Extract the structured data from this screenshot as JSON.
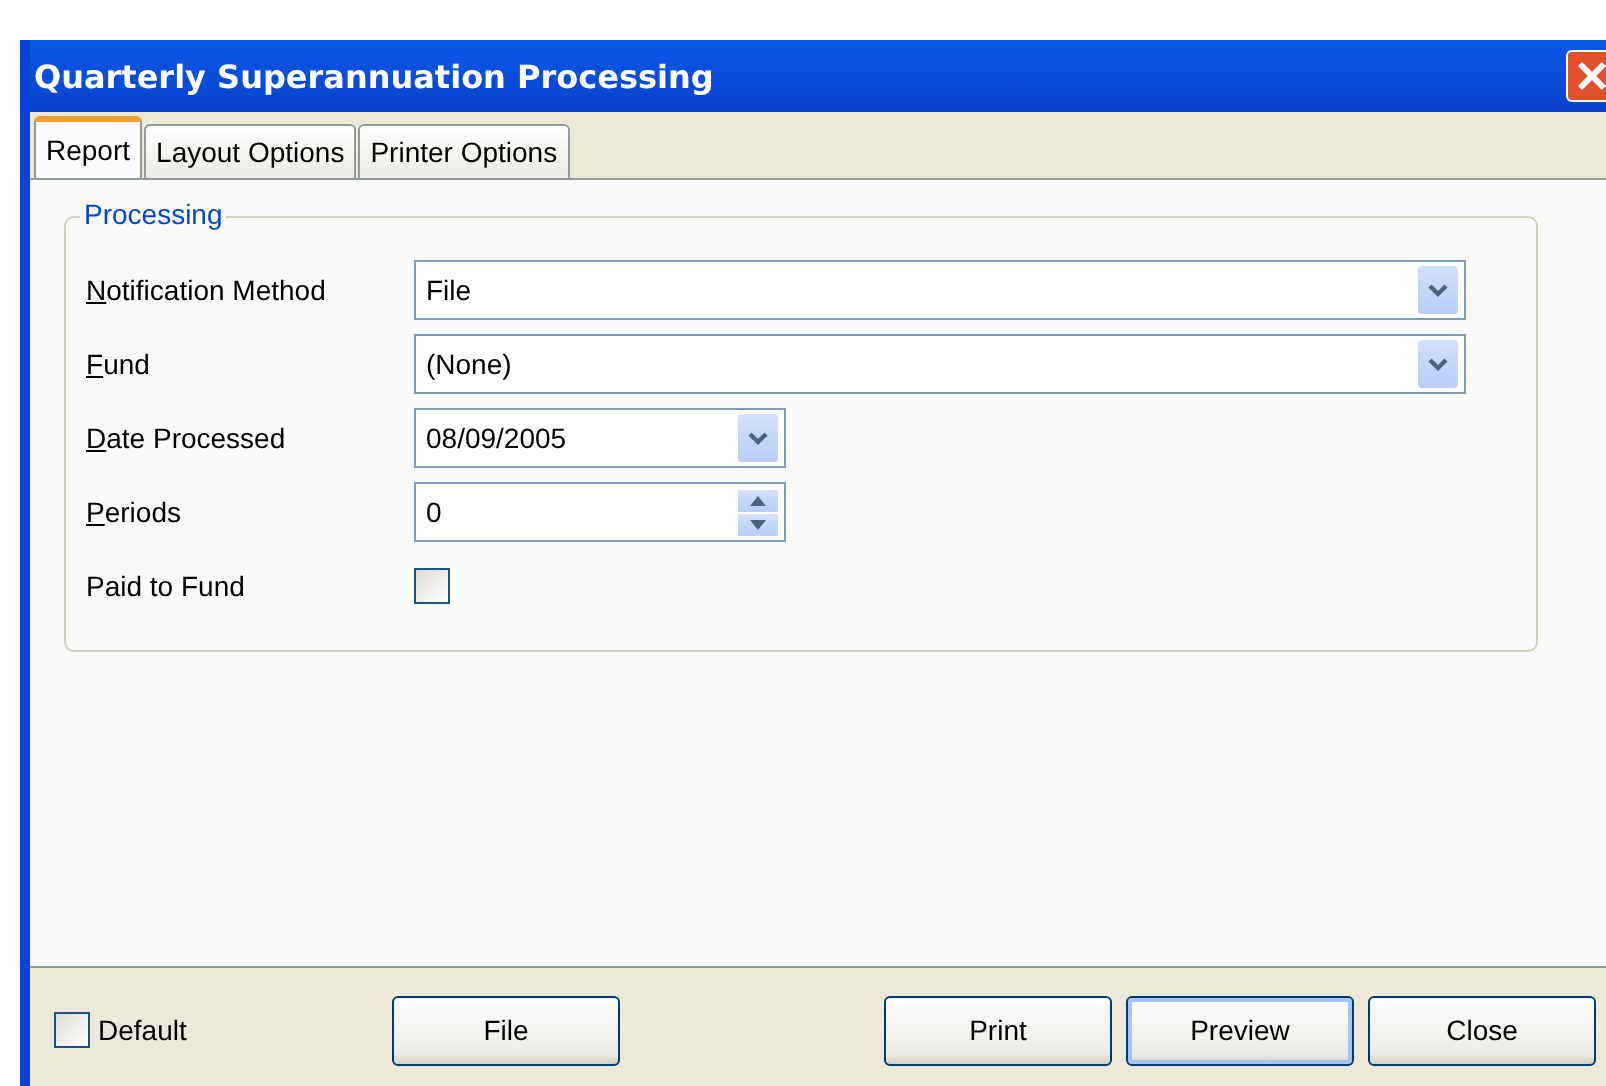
{
  "window": {
    "title": "Quarterly Superannuation Processing"
  },
  "tabs": [
    {
      "label": "Report",
      "selected": true
    },
    {
      "label": "Layout Options",
      "selected": false
    },
    {
      "label": "Printer Options",
      "selected": false
    }
  ],
  "group": {
    "title": "Processing"
  },
  "fields": [
    {
      "kind": "dropdown",
      "label": "Notification Method",
      "underlined": true,
      "value": "File"
    },
    {
      "kind": "dropdown",
      "label": "Fund",
      "underlined": true,
      "value": "(None)"
    },
    {
      "kind": "date",
      "label": "Date Processed",
      "underlined": true,
      "value": "08/09/2005"
    },
    {
      "kind": "spin",
      "label": "Periods",
      "underlined": true,
      "value": "0"
    },
    {
      "kind": "checkbox",
      "label": "Paid to Fund",
      "underlined": false,
      "checked": false
    }
  ],
  "footer": {
    "default": {
      "label": "Default",
      "checked": false
    },
    "buttons": [
      {
        "label": "File",
        "focused": false
      },
      {
        "label": "Print",
        "focused": false
      },
      {
        "label": "Preview",
        "focused": true
      },
      {
        "label": "Close",
        "focused": false
      }
    ]
  }
}
